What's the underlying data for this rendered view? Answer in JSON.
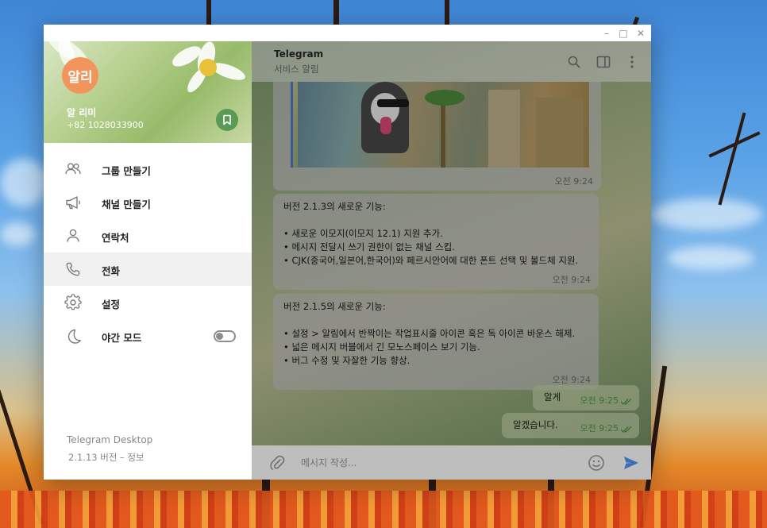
{
  "window": {
    "controls": [
      "–",
      "□",
      "✕"
    ]
  },
  "menu": {
    "avatar_text": "알리",
    "user_name": "알 리미",
    "user_phone": "+82 1028033900",
    "items": [
      {
        "label": "그룹 만들기",
        "icon": "group-icon"
      },
      {
        "label": "채널 만들기",
        "icon": "megaphone-icon"
      },
      {
        "label": "연락처",
        "icon": "user-icon"
      },
      {
        "label": "전화",
        "icon": "phone-icon"
      },
      {
        "label": "설정",
        "icon": "gear-icon"
      },
      {
        "label": "야간 모드",
        "icon": "moon-icon"
      }
    ],
    "night_mode_on": false,
    "footer_title": "Telegram Desktop",
    "footer_version": "2.1.13 버전 – 정보"
  },
  "chat": {
    "title": "Telegram",
    "subtitle": "서비스 알림",
    "messages": [
      {
        "time": "오전 9:24"
      },
      {
        "text": "버전 2.1.3의 새로운 기능:\n\n• 새로운 이모지(이모지 12.1) 지원 추가.\n• 메시지 전달시 쓰기 권한이 없는 채널 스킵.\n• CJK(중국어,일본어,한국어)와 페르시안어에 대한 폰트 선택 및 볼드체 지원.",
        "time": "오전 9:24"
      },
      {
        "text": "버전 2.1.5의 새로운 기능:\n\n• 설정 > 알림에서 반짝이는 작업표시줄 아이콘 혹은 독 아이콘 바운스 해제.\n• 넓은 메시지 버블에서 긴 모노스페이스 보기 기능.\n• 버그 수정 및 자잘한 기능 향상.",
        "time": "오전 9:24"
      },
      {
        "text": "알게",
        "time": "오전 9:25"
      },
      {
        "text": "알겠습니다.",
        "time": "오전 9:25"
      }
    ],
    "composer_placeholder": "메시지 작성..."
  },
  "colors": {
    "accent": "#4e7ed3",
    "avatar": "#f2955c",
    "read_check": "#4f9d4a"
  }
}
